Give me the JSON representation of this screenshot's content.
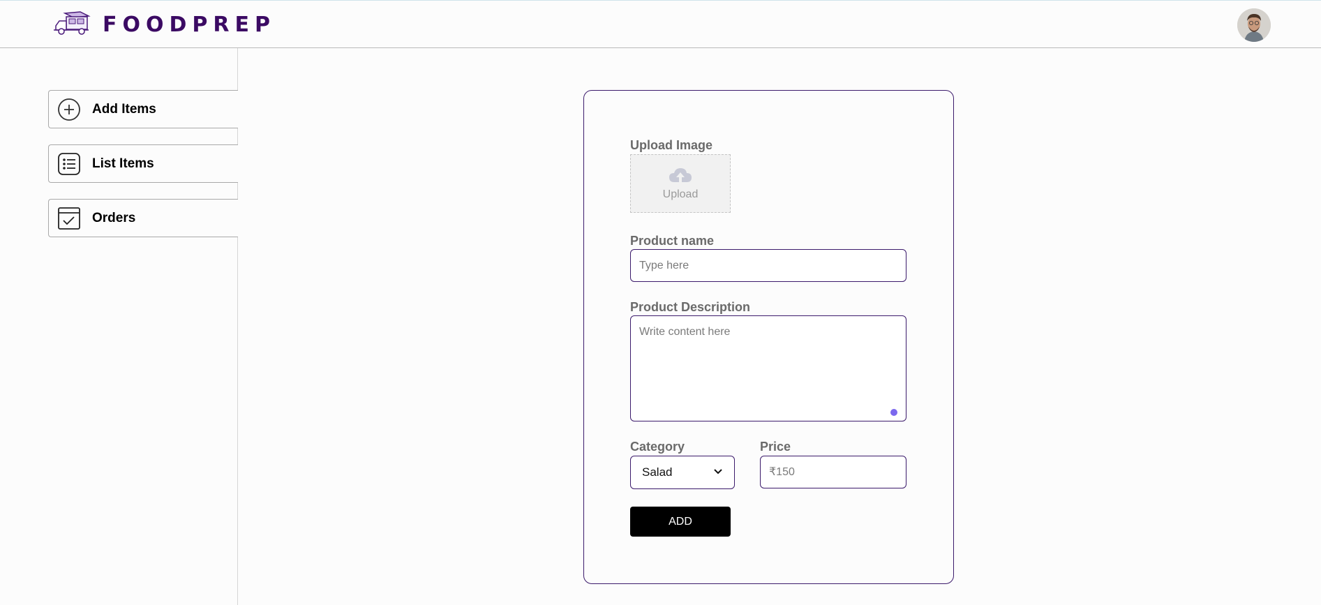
{
  "header": {
    "brand": "FOODPREP",
    "logo_icon": "food-truck-icon",
    "avatar_icon": "user-avatar"
  },
  "sidebar": {
    "items": [
      {
        "label": "Add Items",
        "icon": "plus-circle-icon"
      },
      {
        "label": "List Items",
        "icon": "list-icon"
      },
      {
        "label": "Orders",
        "icon": "check-square-icon"
      }
    ]
  },
  "form": {
    "upload_label": "Upload Image",
    "upload_text": "Upload",
    "name_label": "Product name",
    "name_placeholder": "Type here",
    "description_label": "Product Description",
    "description_placeholder": "Write content here",
    "category_label": "Category",
    "category_value": "Salad",
    "price_label": "Price",
    "price_placeholder": "₹150",
    "add_button": "ADD"
  },
  "colors": {
    "brand": "#3b0a63",
    "form_border": "#3b1a6b",
    "button_bg": "#000000",
    "resize_dot": "#7b68ee"
  }
}
